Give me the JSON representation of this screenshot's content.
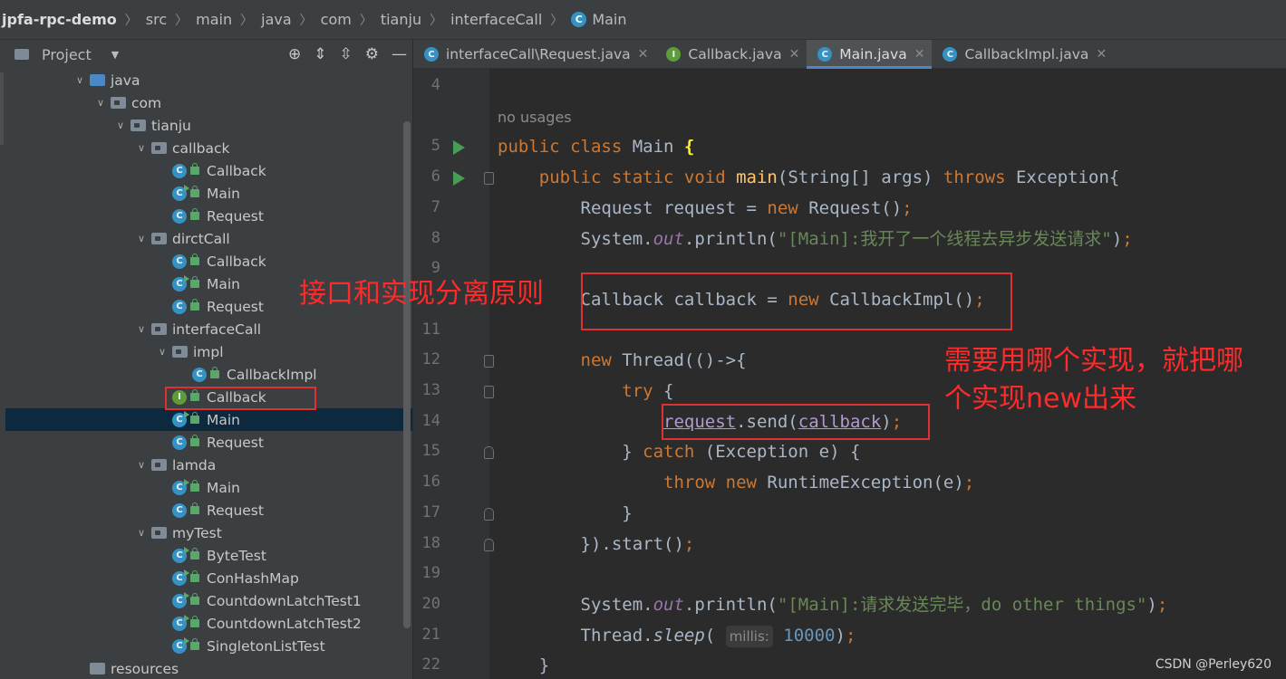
{
  "breadcrumb": [
    "jpfa-rpc-demo",
    "src",
    "main",
    "java",
    "com",
    "tianju",
    "interfaceCall",
    "Main"
  ],
  "project_panel": {
    "title": "Project",
    "tree": [
      {
        "label": "java",
        "type": "folder-blue",
        "depth": 0,
        "expanded": true
      },
      {
        "label": "com",
        "type": "package",
        "depth": 1,
        "expanded": true
      },
      {
        "label": "tianju",
        "type": "package",
        "depth": 2,
        "expanded": true
      },
      {
        "label": "callback",
        "type": "package",
        "depth": 3,
        "expanded": true
      },
      {
        "label": "Callback",
        "type": "class",
        "depth": 4
      },
      {
        "label": "Main",
        "type": "class-run",
        "depth": 4
      },
      {
        "label": "Request",
        "type": "class",
        "depth": 4
      },
      {
        "label": "dirctCall",
        "type": "package",
        "depth": 3,
        "expanded": true
      },
      {
        "label": "Callback",
        "type": "class",
        "depth": 4
      },
      {
        "label": "Main",
        "type": "class-run",
        "depth": 4
      },
      {
        "label": "Request",
        "type": "class",
        "depth": 4
      },
      {
        "label": "interfaceCall",
        "type": "package",
        "depth": 3,
        "expanded": true
      },
      {
        "label": "impl",
        "type": "package",
        "depth": 4,
        "expanded": true
      },
      {
        "label": "CallbackImpl",
        "type": "class",
        "depth": 5
      },
      {
        "label": "Callback",
        "type": "interface",
        "depth": 4
      },
      {
        "label": "Main",
        "type": "class-run",
        "depth": 4,
        "selected": true
      },
      {
        "label": "Request",
        "type": "class",
        "depth": 4
      },
      {
        "label": "lamda",
        "type": "package",
        "depth": 3,
        "expanded": true
      },
      {
        "label": "Main",
        "type": "class-run",
        "depth": 4
      },
      {
        "label": "Request",
        "type": "class",
        "depth": 4
      },
      {
        "label": "myTest",
        "type": "package",
        "depth": 3,
        "expanded": true
      },
      {
        "label": "ByteTest",
        "type": "class-run",
        "depth": 4
      },
      {
        "label": "ConHashMap",
        "type": "class-run",
        "depth": 4
      },
      {
        "label": "CountdownLatchTest1",
        "type": "class-run",
        "depth": 4
      },
      {
        "label": "CountdownLatchTest2",
        "type": "class-run",
        "depth": 4
      },
      {
        "label": "SingletonListTest",
        "type": "class-run",
        "depth": 4
      },
      {
        "label": "resources",
        "type": "folder",
        "depth": 0
      }
    ]
  },
  "tabs": [
    {
      "label": "interfaceCall\\Request.java",
      "icon": "class",
      "active": false
    },
    {
      "label": "Callback.java",
      "icon": "interface",
      "active": false
    },
    {
      "label": "Main.java",
      "icon": "class",
      "active": true
    },
    {
      "label": "CallbackImpl.java",
      "icon": "class",
      "active": false
    }
  ],
  "editor": {
    "usages_hint": "no usages",
    "lines": [
      {
        "num": "4",
        "code": []
      },
      {
        "num": "",
        "hint": true,
        "code": []
      },
      {
        "num": "5",
        "run": true,
        "code": [
          {
            "t": "public class ",
            "c": "kw"
          },
          {
            "t": "Main "
          },
          {
            "t": "{",
            "c": "brace"
          }
        ]
      },
      {
        "num": "6",
        "run": true,
        "fold": "start",
        "code": [
          {
            "t": "    "
          },
          {
            "t": "public static void ",
            "c": "kw"
          },
          {
            "t": "main",
            "c": "fn"
          },
          {
            "t": "(String[] args) "
          },
          {
            "t": "throws ",
            "c": "kw"
          },
          {
            "t": "Exception{"
          }
        ]
      },
      {
        "num": "7",
        "code": [
          {
            "t": "        Request request = "
          },
          {
            "t": "new ",
            "c": "kw"
          },
          {
            "t": "Request()"
          },
          {
            "t": ";",
            "c": "kw"
          }
        ]
      },
      {
        "num": "8",
        "code": [
          {
            "t": "        System."
          },
          {
            "t": "out",
            "c": "st"
          },
          {
            "t": ".println("
          },
          {
            "t": "\"[Main]:我开了一个线程去异步发送请求\"",
            "c": "str"
          },
          {
            "t": ")"
          },
          {
            "t": ";",
            "c": "kw"
          }
        ]
      },
      {
        "num": "9",
        "code": []
      },
      {
        "num": "",
        "code": [
          {
            "t": "        Callback callback = "
          },
          {
            "t": "new ",
            "c": "kw"
          },
          {
            "t": "CallbackImpl()"
          },
          {
            "t": ";",
            "c": "kw"
          }
        ]
      },
      {
        "num": "11",
        "code": []
      },
      {
        "num": "12",
        "fold": "start",
        "code": [
          {
            "t": "        "
          },
          {
            "t": "new ",
            "c": "kw"
          },
          {
            "t": "Thread(()->{"
          }
        ]
      },
      {
        "num": "13",
        "fold": "start",
        "code": [
          {
            "t": "            "
          },
          {
            "t": "try ",
            "c": "kw"
          },
          {
            "t": "{"
          }
        ]
      },
      {
        "num": "14",
        "code": [
          {
            "t": "                "
          },
          {
            "t": "request",
            "c": "ul"
          },
          {
            "t": ".send("
          },
          {
            "t": "callback",
            "c": "ul"
          },
          {
            "t": ")"
          },
          {
            "t": ";",
            "c": "kw"
          }
        ]
      },
      {
        "num": "15",
        "fold": "end",
        "code": [
          {
            "t": "            } "
          },
          {
            "t": "catch ",
            "c": "kw"
          },
          {
            "t": "(Exception e) {"
          }
        ]
      },
      {
        "num": "16",
        "code": [
          {
            "t": "                "
          },
          {
            "t": "throw new ",
            "c": "kw"
          },
          {
            "t": "RuntimeException(e)"
          },
          {
            "t": ";",
            "c": "kw"
          }
        ]
      },
      {
        "num": "17",
        "fold": "end",
        "code": [
          {
            "t": "            }"
          }
        ]
      },
      {
        "num": "18",
        "fold": "end",
        "code": [
          {
            "t": "        }).start()"
          },
          {
            "t": ";",
            "c": "kw"
          }
        ]
      },
      {
        "num": "19",
        "code": []
      },
      {
        "num": "20",
        "code": [
          {
            "t": "        System."
          },
          {
            "t": "out",
            "c": "st"
          },
          {
            "t": ".println("
          },
          {
            "t": "\"[Main]:请求发送完毕，do other things\"",
            "c": "str"
          },
          {
            "t": ")"
          },
          {
            "t": ";",
            "c": "kw"
          }
        ]
      },
      {
        "num": "21",
        "code": [
          {
            "t": "        Thread."
          },
          {
            "t": "sleep",
            "c": "it"
          },
          {
            "t": "( "
          },
          {
            "t": "millis:",
            "c": "ph"
          },
          {
            "t": " "
          },
          {
            "t": "10000",
            "c": "num"
          },
          {
            "t": ")"
          },
          {
            "t": ";",
            "c": "kw"
          }
        ]
      },
      {
        "num": "22",
        "code": [
          {
            "t": "    }"
          }
        ]
      }
    ]
  },
  "annotations": {
    "left_note": "接口和实现分离原则",
    "right_note_line1": "需要用哪个实现，就把哪",
    "right_note_line2": "个实现new出来"
  },
  "watermark": "CSDN @Perley620",
  "colors": {
    "annotation_red": "#e03131",
    "selection_bg": "#0d293e",
    "keyword": "#cc7832",
    "string": "#6a8759"
  }
}
